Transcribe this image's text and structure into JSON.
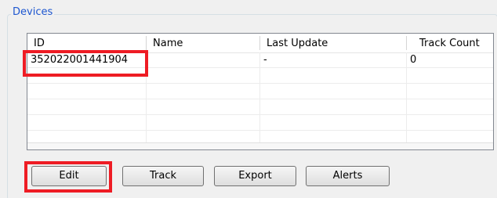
{
  "group": {
    "title": "Devices"
  },
  "table": {
    "columns": [
      "ID",
      "Name",
      "Last Update",
      "Track Count"
    ],
    "rows": [
      {
        "id": "352022001441904",
        "name": "",
        "last_update": "-",
        "track_count": "0"
      }
    ],
    "empty_row_count": 7
  },
  "buttons": {
    "edit": "Edit",
    "track": "Track",
    "export": "Export",
    "alerts": "Alerts"
  },
  "colors": {
    "group_title": "#1e57d0",
    "highlight": "#ee1c24"
  }
}
